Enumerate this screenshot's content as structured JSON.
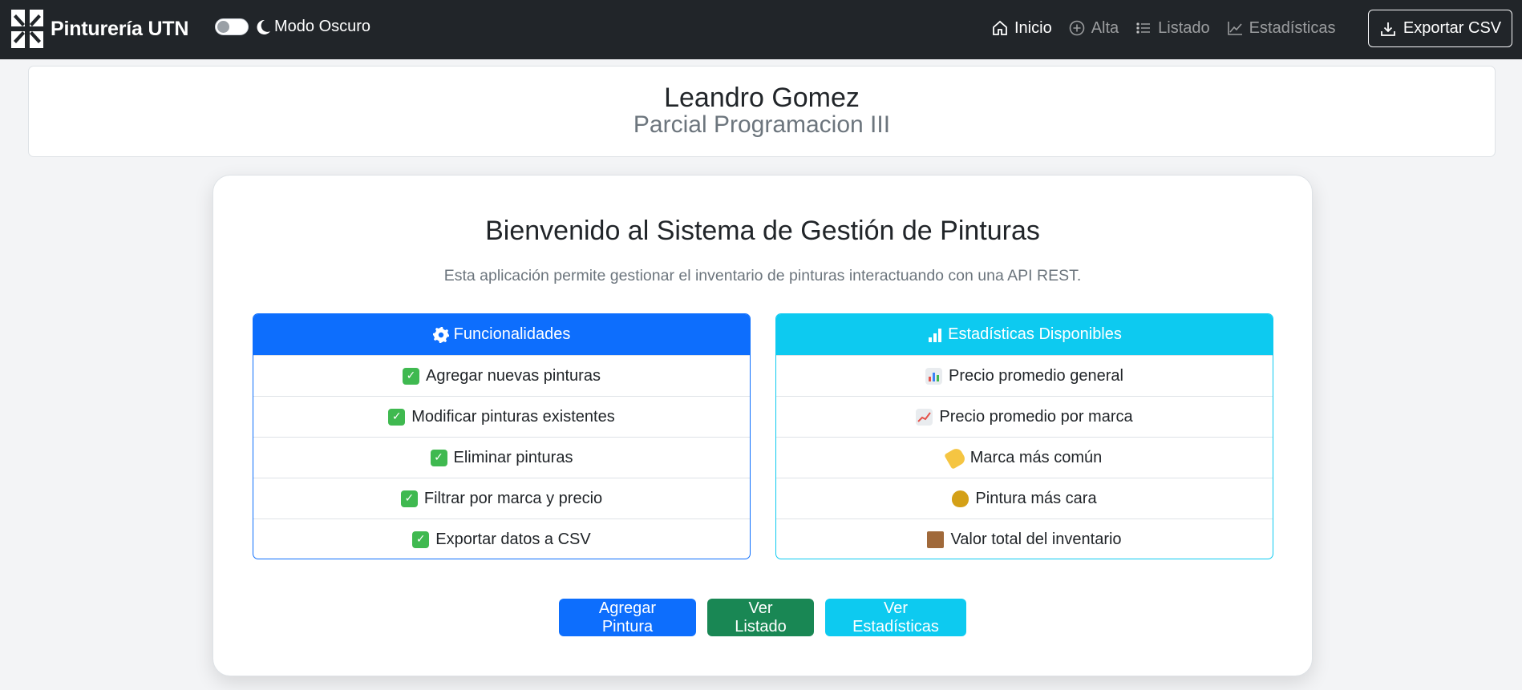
{
  "navbar": {
    "brand": "Pinturería UTN",
    "dark_mode_label": "Modo Oscuro",
    "links": [
      {
        "label": "Inicio",
        "icon": "home-icon",
        "active": true
      },
      {
        "label": "Alta",
        "icon": "plus-circle-icon",
        "active": false
      },
      {
        "label": "Listado",
        "icon": "list-icon",
        "active": false
      },
      {
        "label": "Estadísticas",
        "icon": "line-chart-icon",
        "active": false
      }
    ],
    "export_label": "Exportar CSV"
  },
  "header": {
    "name": "Leandro Gomez",
    "subtitle": "Parcial Programacion III"
  },
  "main": {
    "title": "Bienvenido al Sistema de Gestión de Pinturas",
    "description": "Esta aplicación permite gestionar el inventario de pinturas interactuando con una API REST.",
    "features": {
      "title": "Funcionalidades",
      "icon": "gear-icon",
      "items": [
        {
          "label": "Agregar nuevas pinturas",
          "icon": "check-icon"
        },
        {
          "label": "Modificar pinturas existentes",
          "icon": "check-icon"
        },
        {
          "label": "Eliminar pinturas",
          "icon": "check-icon"
        },
        {
          "label": "Filtrar por marca y precio",
          "icon": "check-icon"
        },
        {
          "label": "Exportar datos a CSV",
          "icon": "check-icon"
        }
      ]
    },
    "stats": {
      "title": "Estadísticas Disponibles",
      "icon": "bar-chart-icon",
      "items": [
        {
          "label": "Precio promedio general",
          "icon": "bar-chart-emoji-icon"
        },
        {
          "label": "Precio promedio por marca",
          "icon": "trend-chart-emoji-icon"
        },
        {
          "label": "Marca más común",
          "icon": "tag-icon"
        },
        {
          "label": "Pintura más cara",
          "icon": "money-bag-icon"
        },
        {
          "label": "Valor total del inventario",
          "icon": "package-icon"
        }
      ]
    },
    "buttons": {
      "add": "Agregar Pintura",
      "list": "Ver Listado",
      "stats": "Ver Estadísticas"
    }
  },
  "colors": {
    "navbar": "#212529",
    "primary": "#0d6efd",
    "success": "#198754",
    "info": "#0dcaf0"
  }
}
